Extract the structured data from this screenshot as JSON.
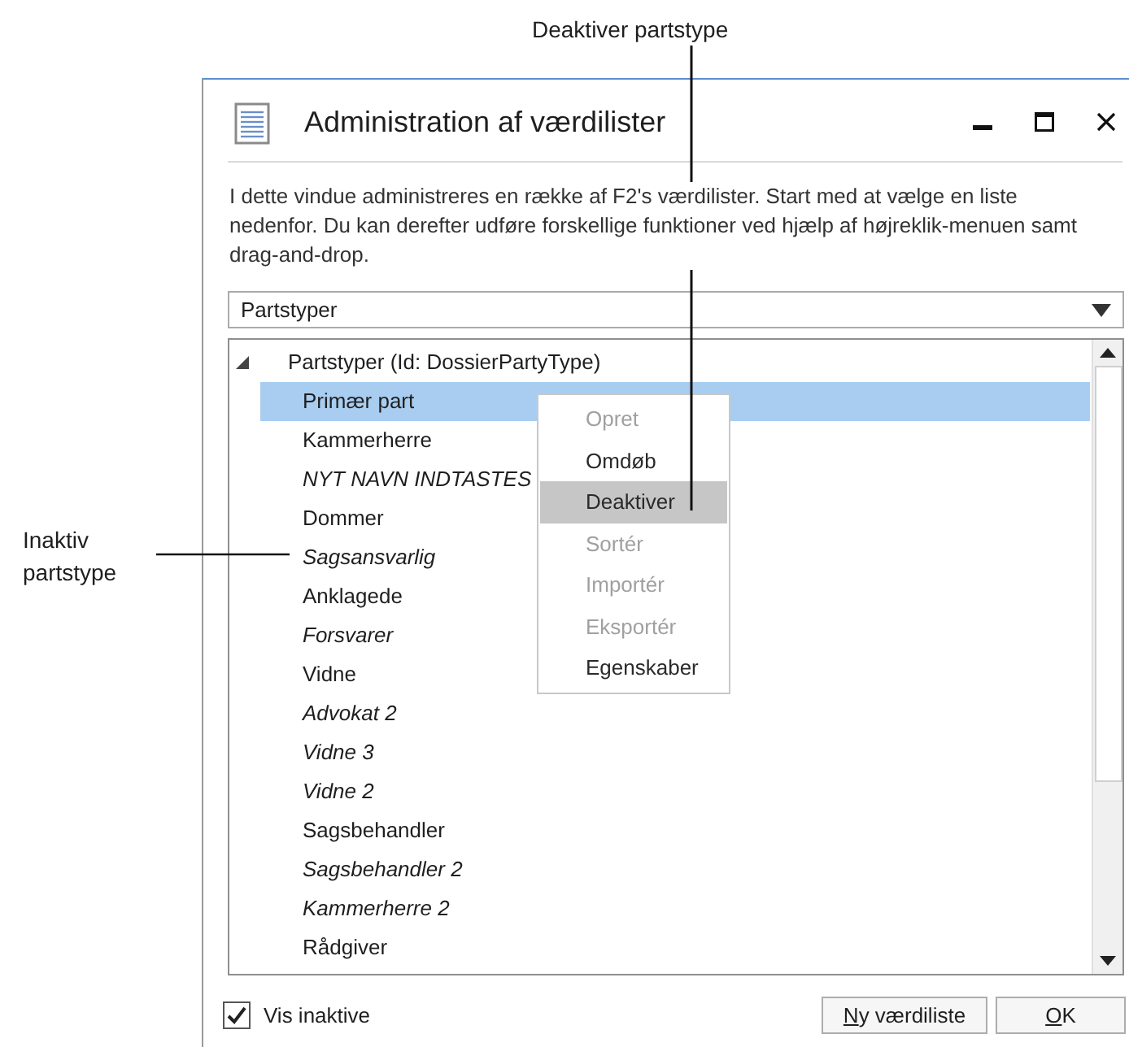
{
  "callouts": [
    {
      "kind": "top",
      "text": "Deaktiver partstype"
    },
    {
      "kind": "left",
      "text": "Inaktiv partstype"
    }
  ],
  "window": {
    "title": "Administration af værdilister"
  },
  "description": "I dette vindue administreres en række af F2's værdilister. Start med at vælge en liste nedenfor. Du kan derefter udføre forskellige funktioner ved hjælp af højreklik-menuen samt drag-and-drop.",
  "list_select": {
    "value": "Partstyper"
  },
  "tree": {
    "label": "Partstyper (Id: DossierPartyType)",
    "expanded": true,
    "children": [
      {
        "label": "Primær part",
        "inactive": false,
        "selected": true
      },
      {
        "label": "Kammerherre",
        "inactive": false,
        "selected": false
      },
      {
        "label": "NYT NAVN INDTASTES",
        "inactive": true,
        "selected": false
      },
      {
        "label": "Dommer",
        "inactive": false,
        "selected": false
      },
      {
        "label": "Sagsansvarlig",
        "inactive": true,
        "selected": false
      },
      {
        "label": "Anklagede",
        "inactive": false,
        "selected": false
      },
      {
        "label": "Forsvarer",
        "inactive": true,
        "selected": false
      },
      {
        "label": "Vidne",
        "inactive": false,
        "selected": false
      },
      {
        "label": "Advokat 2",
        "inactive": true,
        "selected": false
      },
      {
        "label": "Vidne 3",
        "inactive": true,
        "selected": false
      },
      {
        "label": "Vidne 2",
        "inactive": true,
        "selected": false
      },
      {
        "label": "Sagsbehandler",
        "inactive": false,
        "selected": false
      },
      {
        "label": "Sagsbehandler 2",
        "inactive": true,
        "selected": false
      },
      {
        "label": "Kammerherre 2",
        "inactive": true,
        "selected": false
      },
      {
        "label": "Rådgiver",
        "inactive": false,
        "selected": false
      }
    ]
  },
  "context_menu": [
    {
      "label": "Opret",
      "disabled": true,
      "selected": false
    },
    {
      "label": "Omdøb",
      "disabled": false,
      "selected": false
    },
    {
      "label": "Deaktiver",
      "disabled": false,
      "selected": true
    },
    {
      "label": "Sortér",
      "disabled": true,
      "selected": false
    },
    {
      "label": "Importér",
      "disabled": true,
      "selected": false
    },
    {
      "label": "Eksportér",
      "disabled": true,
      "selected": false
    },
    {
      "label": "Egenskaber",
      "disabled": false,
      "selected": false
    }
  ],
  "show_inactive": {
    "label": "Vis inaktive",
    "checked": true
  },
  "buttons": [
    {
      "label": "Ny værdiliste"
    },
    {
      "label": "OK"
    }
  ]
}
